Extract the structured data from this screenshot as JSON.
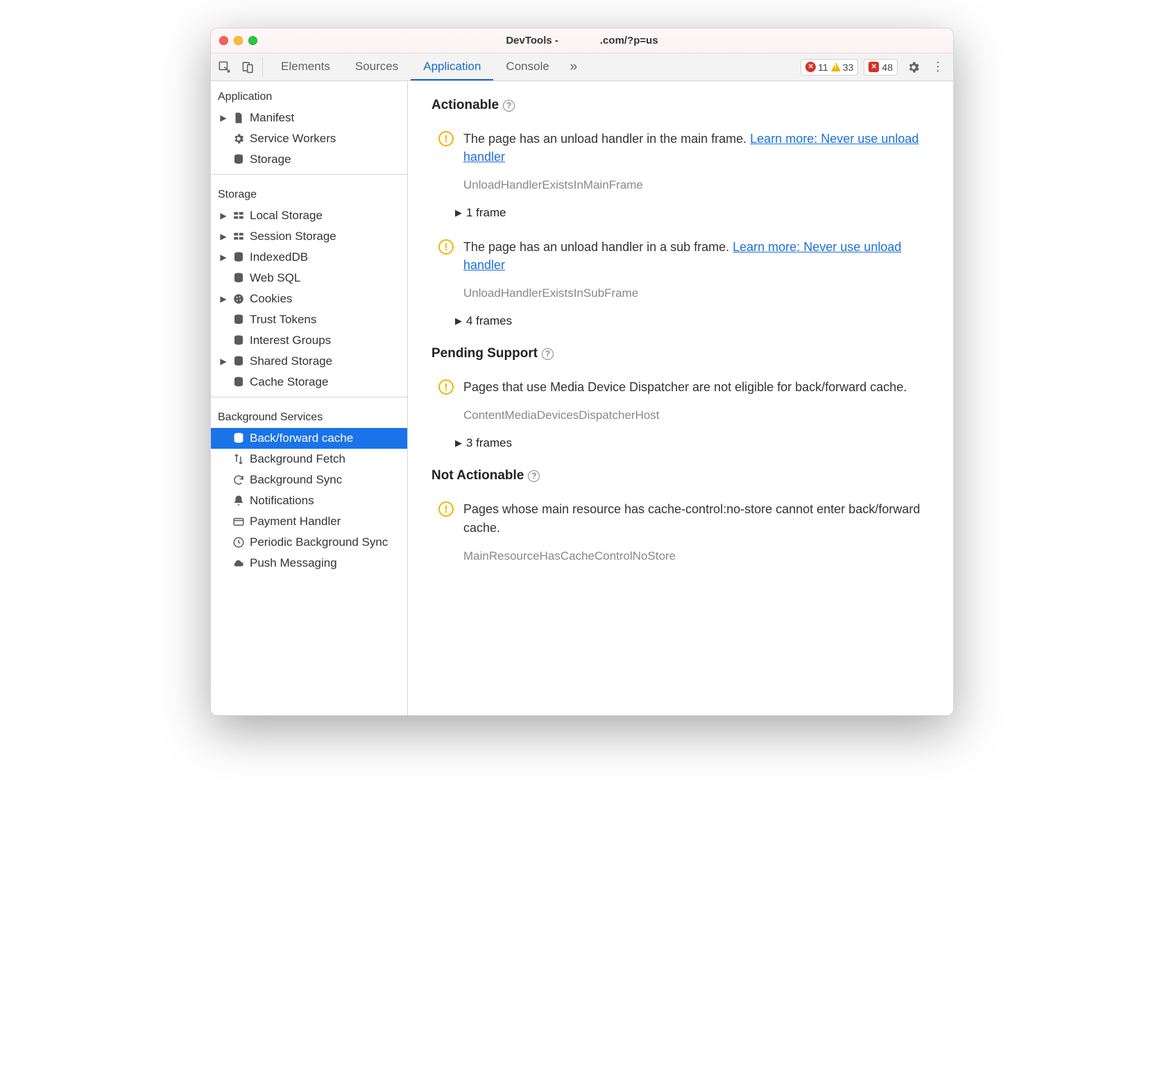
{
  "window": {
    "title_left": "DevTools -",
    "title_right": ".com/?p=us"
  },
  "tabbar": {
    "tabs": [
      "Elements",
      "Sources",
      "Application",
      "Console"
    ],
    "active_index": 2,
    "errors": "11",
    "warnings": "33",
    "issues": "48"
  },
  "sidebar": {
    "sections": [
      {
        "label": "Application",
        "items": [
          {
            "icon": "file",
            "label": "Manifest",
            "expandable": true
          },
          {
            "icon": "gear",
            "label": "Service Workers",
            "expandable": false
          },
          {
            "icon": "db",
            "label": "Storage",
            "expandable": false
          }
        ]
      },
      {
        "label": "Storage",
        "items": [
          {
            "icon": "grid",
            "label": "Local Storage",
            "expandable": true
          },
          {
            "icon": "grid",
            "label": "Session Storage",
            "expandable": true
          },
          {
            "icon": "db",
            "label": "IndexedDB",
            "expandable": true
          },
          {
            "icon": "db",
            "label": "Web SQL",
            "expandable": false
          },
          {
            "icon": "cookie",
            "label": "Cookies",
            "expandable": true
          },
          {
            "icon": "db",
            "label": "Trust Tokens",
            "expandable": false
          },
          {
            "icon": "db",
            "label": "Interest Groups",
            "expandable": false
          },
          {
            "icon": "db",
            "label": "Shared Storage",
            "expandable": true
          },
          {
            "icon": "db",
            "label": "Cache Storage",
            "expandable": false
          }
        ]
      },
      {
        "label": "Background Services",
        "items": [
          {
            "icon": "db",
            "label": "Back/forward cache",
            "selected": true
          },
          {
            "icon": "updown",
            "label": "Background Fetch"
          },
          {
            "icon": "sync",
            "label": "Background Sync"
          },
          {
            "icon": "bell",
            "label": "Notifications"
          },
          {
            "icon": "card",
            "label": "Payment Handler"
          },
          {
            "icon": "clock",
            "label": "Periodic Background Sync"
          },
          {
            "icon": "cloud",
            "label": "Push Messaging"
          }
        ]
      }
    ]
  },
  "content": {
    "groups": [
      {
        "title": "Actionable",
        "issues": [
          {
            "msg": "The page has an unload handler in the main frame. ",
            "link": "Learn more: Never use unload handler",
            "code": "UnloadHandlerExistsInMainFrame",
            "frames": "1 frame"
          },
          {
            "msg": "The page has an unload handler in a sub frame. ",
            "link": "Learn more: Never use unload handler",
            "code": "UnloadHandlerExistsInSubFrame",
            "frames": "4 frames"
          }
        ]
      },
      {
        "title": "Pending Support",
        "issues": [
          {
            "msg": "Pages that use Media Device Dispatcher are not eligible for back/forward cache.",
            "link": "",
            "code": "ContentMediaDevicesDispatcherHost",
            "frames": "3 frames"
          }
        ]
      },
      {
        "title": "Not Actionable",
        "issues": [
          {
            "msg": "Pages whose main resource has cache-control:no-store cannot enter back/forward cache.",
            "link": "",
            "code": "MainResourceHasCacheControlNoStore",
            "frames": ""
          }
        ]
      }
    ]
  }
}
